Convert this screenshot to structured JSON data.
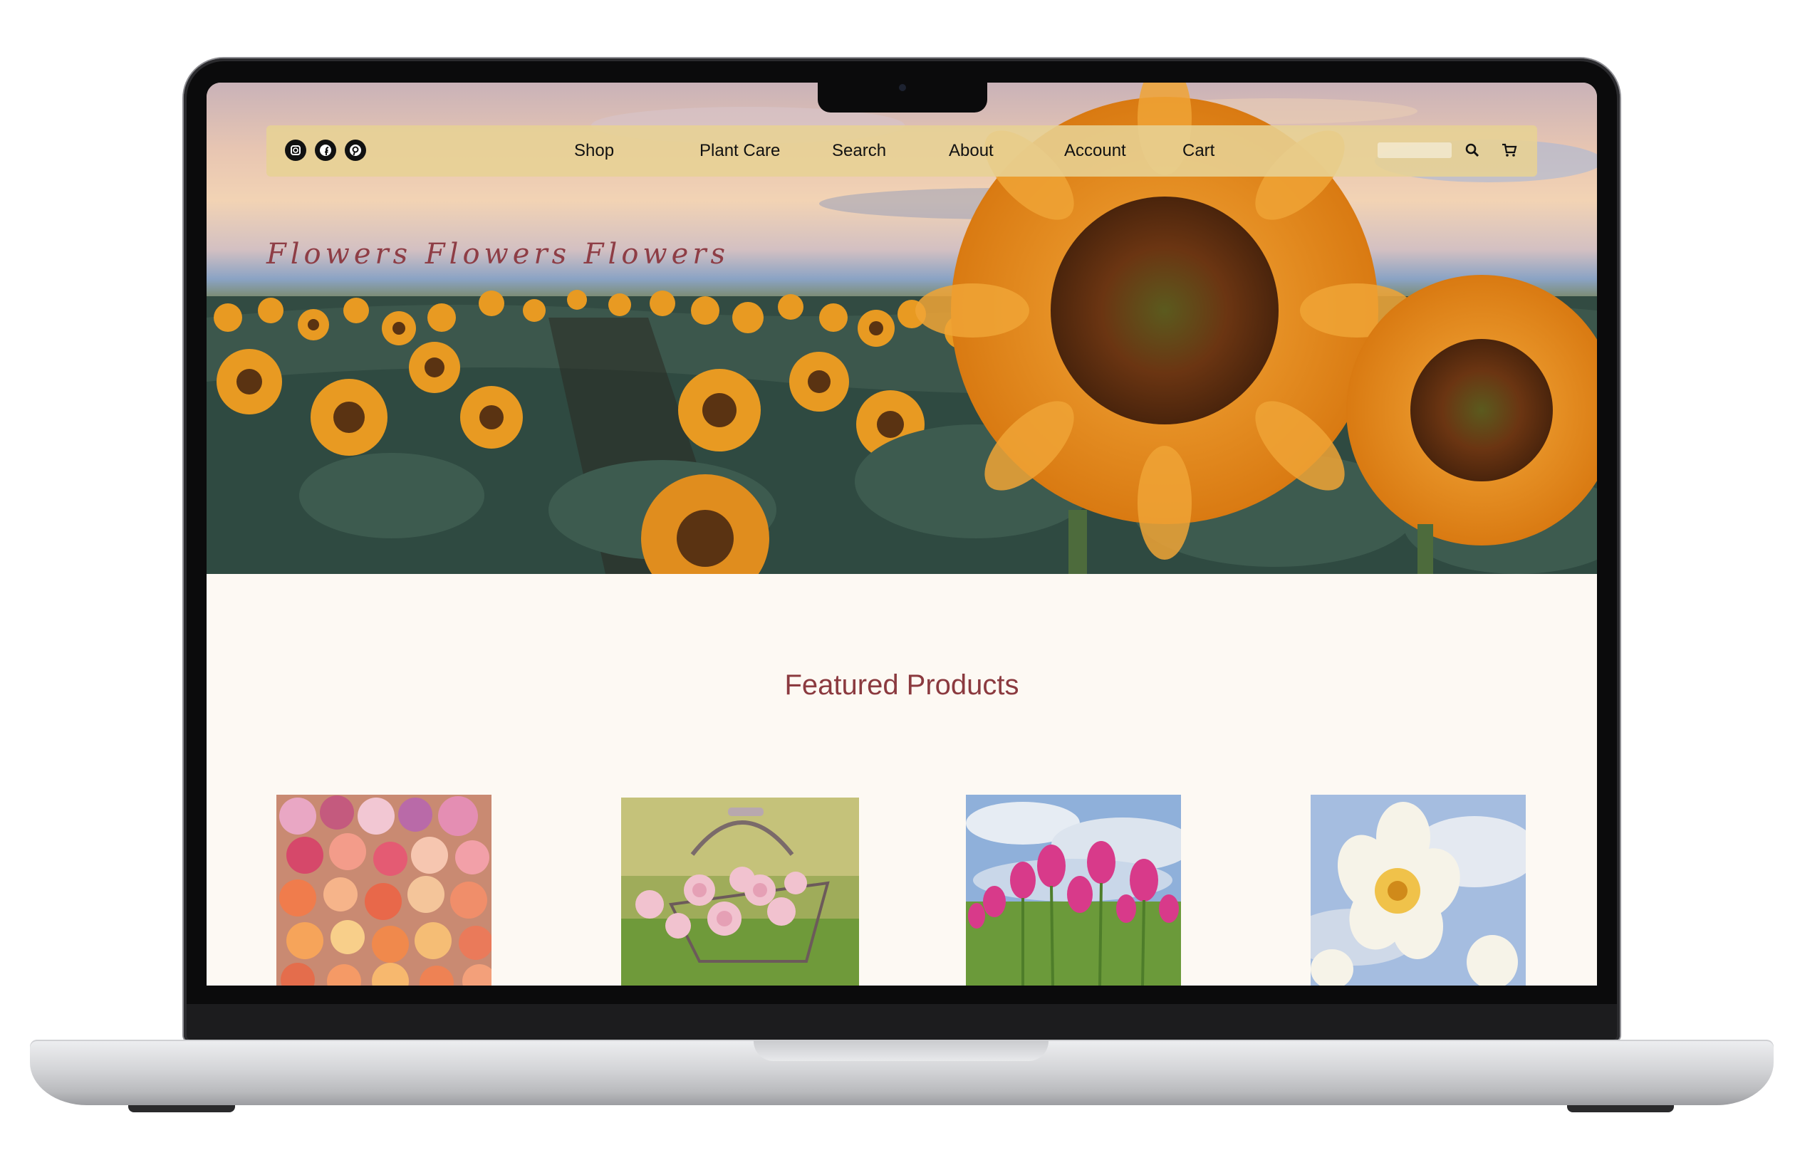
{
  "nav": {
    "social": [
      {
        "icon": "instagram-icon"
      },
      {
        "icon": "facebook-icon"
      },
      {
        "icon": "pinterest-icon"
      }
    ],
    "items": [
      "Shop",
      "Plant Care",
      "Search",
      "About",
      "Account",
      "Cart"
    ],
    "search_placeholder": "",
    "search_icon": "search-icon",
    "cart_icon": "cart-icon"
  },
  "hero": {
    "title": "Flowers Flowers Flowers"
  },
  "featured": {
    "title": "Featured Products"
  },
  "colors": {
    "accent": "#8b3a3f",
    "nav_bg": "#e7d294",
    "page_bg": "#fdf9f3"
  }
}
